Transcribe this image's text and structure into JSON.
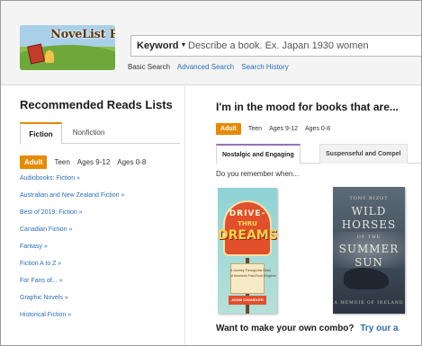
{
  "header": {
    "logo_text": "NoveList Plus",
    "search": {
      "field_label": "Keyword",
      "placeholder": "Describe a book. Ex. Japan 1930 women"
    },
    "links": {
      "basic": "Basic Search",
      "advanced": "Advanced Search",
      "history": "Search History"
    }
  },
  "recommended": {
    "title": "Recommended Reads Lists",
    "tabs": [
      "Fiction",
      "Nonfiction"
    ],
    "audiences": [
      "Adult",
      "Teen",
      "Ages 9-12",
      "Ages 0-8"
    ],
    "items": [
      "Audiobooks: Fiction »",
      "Australian and New Zealand Fiction »",
      "Best of 2019: Fiction »",
      "Canadian Fiction »",
      "Fantasy »",
      "Fiction A to Z »",
      "For Fans of... »",
      "Graphic Novels »",
      "Historical Fiction »"
    ]
  },
  "mood": {
    "title": "I'm in the mood for books that are...",
    "audiences": [
      "Adult",
      "Teen",
      "Ages 9-12",
      "Ages 0-8"
    ],
    "tabs": [
      "Nostalgic and Engaging",
      "Suspenseful and Compel"
    ],
    "prompt": "Do you remember when...",
    "books": [
      {
        "title_line1": "DRIVE-",
        "title_line2": "THRU",
        "title_line3": "DREAMS",
        "subtitle_line1": "A Journey Through the Heart",
        "subtitle_line2": "of America's Fast-Food Kingdom",
        "author": "ADAM CHANDLER"
      },
      {
        "author": "TONY BIZOT",
        "title_line1": "WILD",
        "title_line2": "HORSES",
        "title_line3": "OF THE",
        "title_line4": "SUMMER",
        "title_line5": "SUN",
        "subtitle": "A MEMOIR OF IRELAND"
      }
    ],
    "combo_text": "Want to make your own combo?",
    "combo_link": "Try our a"
  },
  "colors": {
    "accent_orange": "#e68a00",
    "link_blue": "#2a6fb5",
    "nostalgic_tab_accent": "#9a6fb8"
  }
}
